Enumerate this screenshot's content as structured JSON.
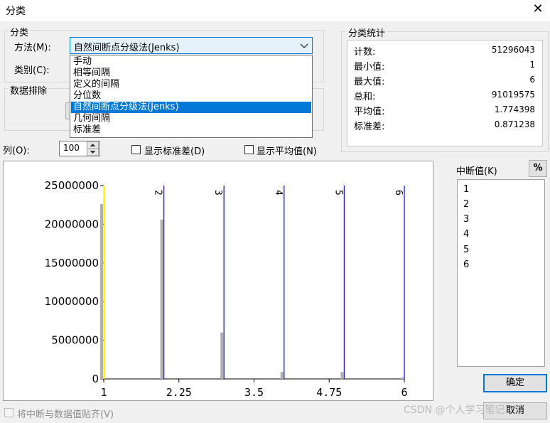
{
  "window": {
    "title": "分类",
    "close_glyph": "✕"
  },
  "classification": {
    "group_label": "分类",
    "method_label": "方法(M):",
    "method_selected": "自然间断点分级法(Jenks)",
    "category_label": "类别(C):",
    "method_options": [
      "手动",
      "相等间隔",
      "定义的间隔",
      "分位数",
      "自然间断点分级法(Jenks)",
      "几何间隔",
      "标准差"
    ],
    "selected_index": 4
  },
  "exclusion": {
    "group_label": "数据排除"
  },
  "stats": {
    "group_label": "分类统计",
    "rows": [
      {
        "label": "计数:",
        "value": "51296043"
      },
      {
        "label": "最小值:",
        "value": "1"
      },
      {
        "label": "最大值:",
        "value": "6"
      },
      {
        "label": "总和:",
        "value": "91019575"
      },
      {
        "label": "平均值:",
        "value": "1.774398"
      },
      {
        "label": "标准差:",
        "value": "0.871238"
      }
    ]
  },
  "columns": {
    "label": "列(O):",
    "value": "100"
  },
  "options": {
    "show_std_label": "显示标准差(D)",
    "show_mean_label": "显示平均值(N)",
    "snap_label": "将中断与数据值贴齐(V)"
  },
  "breaks": {
    "label": "中断值(K)",
    "percent_button": "%",
    "values": [
      "1",
      "2",
      "3",
      "4",
      "5",
      "6"
    ]
  },
  "buttons": {
    "ok": "确定",
    "cancel": "取消"
  },
  "watermark": "CSDN @个人学习笔记",
  "colors": {
    "accent": "#0078d7",
    "break_line": "#1a1acc",
    "histogram_bar": "#b0b0b0",
    "mean_line": "#ffe600"
  },
  "chart_data": {
    "type": "bar",
    "xlim": [
      1,
      6
    ],
    "ylim": [
      0,
      25000000
    ],
    "x_ticks": [
      "1",
      "2.25",
      "3.5",
      "4.75",
      "6"
    ],
    "y_ticks": [
      "0",
      "5000000",
      "10000000",
      "15000000",
      "20000000",
      "25000000"
    ],
    "bars": [
      {
        "x": 1,
        "value": 22600000
      },
      {
        "x": 2,
        "value": 20600000
      },
      {
        "x": 3,
        "value": 6000000
      },
      {
        "x": 4,
        "value": 900000
      },
      {
        "x": 5,
        "value": 900000
      },
      {
        "x": 6,
        "value": 200000
      }
    ],
    "break_values": [
      2,
      3,
      4,
      5,
      6
    ],
    "break_labels": [
      "2",
      "3",
      "4",
      "5",
      "6"
    ]
  }
}
